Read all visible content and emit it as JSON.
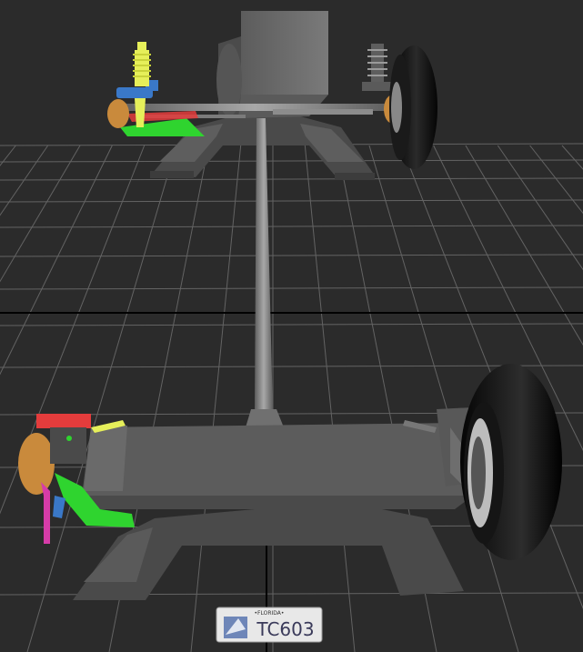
{
  "scene": {
    "background": "#2b2b2b",
    "grid_color": "#6a6a6a",
    "horizon_color": "#000000",
    "chassis_color": "#5a5a5a",
    "tire_color": "#0a0a0a",
    "spring_color": "#e6ef5a",
    "control_arm_color": "#2fd42f",
    "tie_rod_color": "#e43c3c",
    "knuckle_color": "#c98a3c",
    "strut_color": "#3a78c8",
    "link_color": "#d63ca8"
  },
  "license_plate": {
    "text": "TC603",
    "top_text": "•FLORIDA•"
  }
}
